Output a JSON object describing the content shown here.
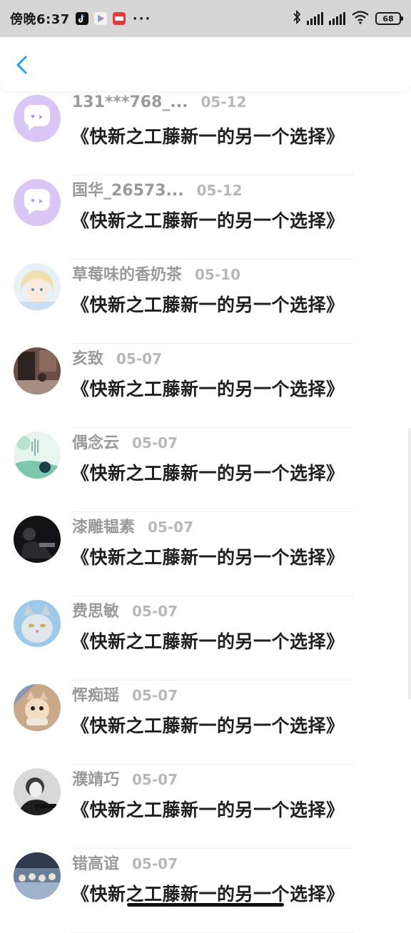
{
  "status_bar": {
    "time": "傍晚6:37",
    "more": "···",
    "battery": "68"
  },
  "header": {
    "back_icon": "chevron-left-icon",
    "accent": "#2a9df4"
  },
  "comments": [
    {
      "name": "131***768_...",
      "date": "05-12",
      "text": "《快新之工藤新一的另一个选择》",
      "avatar": "default-chat"
    },
    {
      "name": "国华_26573...",
      "date": "05-12",
      "text": "《快新之工藤新一的另一个选择》",
      "avatar": "default-chat"
    },
    {
      "name": "草莓味的香奶茶",
      "date": "05-10",
      "text": "《快新之工藤新一的另一个选择》",
      "avatar": "anime-boy"
    },
    {
      "name": "亥致",
      "date": "05-07",
      "text": "《快新之工藤新一的另一个选择》",
      "avatar": "photo-room"
    },
    {
      "name": "偶念云",
      "date": "05-07",
      "text": "《快新之工藤新一的另一个选择》",
      "avatar": "photo-green"
    },
    {
      "name": "漆雕韫素",
      "date": "05-07",
      "text": "《快新之工藤新一的另一个选择》",
      "avatar": "photo-dark"
    },
    {
      "name": "费思敏",
      "date": "05-07",
      "text": "《快新之工藤新一的另一个选择》",
      "avatar": "cat-cartoon"
    },
    {
      "name": "恽痴瑶",
      "date": "05-07",
      "text": "《快新之工藤新一的另一个选择》",
      "avatar": "kitten"
    },
    {
      "name": "濮靖巧",
      "date": "05-07",
      "text": "《快新之工藤新一的另一个选择》",
      "avatar": "bw-person"
    },
    {
      "name": "错高谊",
      "date": "05-07",
      "text": "《快新之工藤新一的另一个选择》",
      "avatar": "crowd-photo"
    }
  ]
}
